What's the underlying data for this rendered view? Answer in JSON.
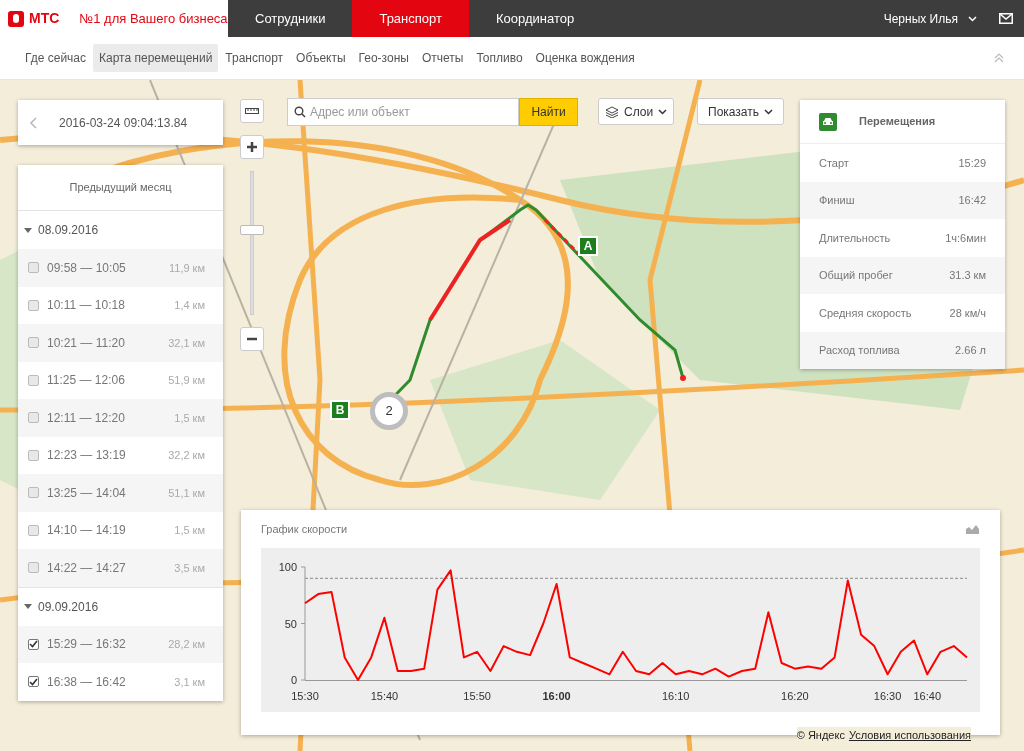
{
  "header": {
    "logo": "МТС",
    "slogan": "№1 для Вашего бизнеса",
    "tabs": [
      {
        "label": "Сотрудники",
        "selected": false
      },
      {
        "label": "Транспорт",
        "selected": true
      },
      {
        "label": "Координатор",
        "selected": false
      }
    ],
    "user": "Черных Илья"
  },
  "subnav": [
    {
      "label": "Где сейчас",
      "selected": false
    },
    {
      "label": "Карта перемещений",
      "selected": true
    },
    {
      "label": "Транспорт",
      "selected": false
    },
    {
      "label": "Объекты",
      "selected": false
    },
    {
      "label": "Гео-зоны",
      "selected": false
    },
    {
      "label": "Отчеты",
      "selected": false
    },
    {
      "label": "Топливо",
      "selected": false
    },
    {
      "label": "Оценка вождения",
      "selected": false
    }
  ],
  "map": {
    "search": {
      "placeholder": "Адрес или объект",
      "button": "Найти"
    },
    "layers_button": "Слои",
    "show_button": "Показать",
    "markers": [
      {
        "kind": "start",
        "label": "A"
      },
      {
        "kind": "finish",
        "label": "B"
      },
      {
        "kind": "cluster",
        "label": "2"
      }
    ],
    "zoom": {
      "level": 0.6
    },
    "copyright": "© Яндекс",
    "terms_link": "Условия использования"
  },
  "history": {
    "date": "2016-03-24 09:04:13.84",
    "period": "Предыдущий месяц",
    "groups": [
      {
        "date": "08.09.2016",
        "expanded": true,
        "trips": [
          {
            "time": "09:58 — 10:05",
            "distance": "11,9 км",
            "checked": false
          },
          {
            "time": "10:11 — 10:18",
            "distance": "1,4 км",
            "checked": false
          },
          {
            "time": "10:21 — 11:20",
            "distance": "32,1 км",
            "checked": false
          },
          {
            "time": "11:25 — 12:06",
            "distance": "51,9 км",
            "checked": false
          },
          {
            "time": "12:11 — 12:20",
            "distance": "1,5 км",
            "checked": false
          },
          {
            "time": "12:23 — 13:19",
            "distance": "32,2 км",
            "checked": false
          },
          {
            "time": "13:25 — 14:04",
            "distance": "51,1 км",
            "checked": false
          },
          {
            "time": "14:10 — 14:19",
            "distance": "1,5 км",
            "checked": false
          },
          {
            "time": "14:22 — 14:27",
            "distance": "3,5 км",
            "checked": false
          }
        ]
      },
      {
        "date": "09.09.2016",
        "expanded": true,
        "trips": [
          {
            "time": "15:29 — 16:32",
            "distance": "28,2 км",
            "checked": true
          },
          {
            "time": "16:38 — 16:42",
            "distance": "3,1 км",
            "checked": true
          }
        ]
      }
    ]
  },
  "summary": {
    "title": "Перемещения",
    "rows": [
      {
        "label": "Старт",
        "value": "15:29"
      },
      {
        "label": "Финиш",
        "value": "16:42"
      },
      {
        "label": "Длительность",
        "value": "1ч:6мин"
      },
      {
        "label": "Общий пробег",
        "value": "31.3 км"
      },
      {
        "label": "Средняя скорость",
        "value": "28 км/ч"
      },
      {
        "label": "Расход топлива",
        "value": "2.66 л"
      }
    ]
  },
  "speed_chart": {
    "title": "График скорости",
    "chart_data": {
      "type": "line",
      "categories": [
        "15:30",
        null,
        null,
        null,
        null,
        null,
        "15:40",
        null,
        null,
        null,
        null,
        null,
        null,
        "15:50",
        null,
        null,
        null,
        null,
        null,
        "**16:00**",
        null,
        null,
        null,
        null,
        null,
        null,
        null,
        null,
        "16:10",
        null,
        null,
        null,
        null,
        null,
        null,
        null,
        null,
        "16:20",
        null,
        null,
        null,
        null,
        null,
        null,
        "16:30",
        null,
        null,
        "16:40",
        null,
        null,
        null
      ],
      "series": [
        {
          "color": "#ff0000",
          "values": [
            68,
            76,
            78,
            20,
            0,
            20,
            55,
            8,
            8,
            10,
            80,
            97,
            20,
            25,
            8,
            30,
            25,
            22,
            50,
            85,
            20,
            15,
            10,
            5,
            25,
            8,
            5,
            15,
            5,
            8,
            5,
            10,
            3,
            8,
            10,
            60,
            15,
            10,
            12,
            10,
            20,
            88,
            40,
            30,
            5,
            25,
            35,
            5,
            25,
            30,
            20
          ]
        }
      ],
      "ylim": [
        0,
        100
      ],
      "yticks": [
        0,
        50,
        100
      ],
      "ref_lines": [
        {
          "axis": "y",
          "value": 90
        }
      ]
    }
  }
}
